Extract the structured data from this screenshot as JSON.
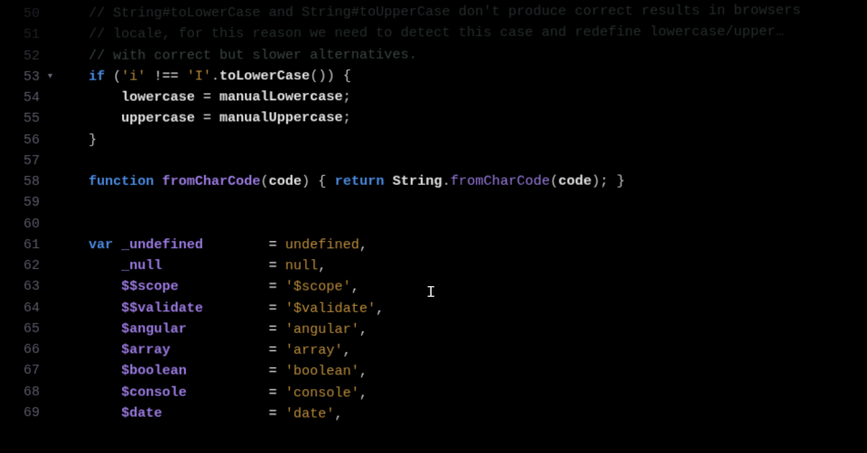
{
  "lines": [
    {
      "num": 50,
      "indent": 1,
      "tokens": [
        [
          "comment",
          "// String#toLowerCase and String#toUpperCase don't produce correct results in browsers"
        ]
      ],
      "dim": "dimmer"
    },
    {
      "num": 51,
      "indent": 1,
      "tokens": [
        [
          "comment",
          "// locale, for this reason we need to detect this case and redefine lowercase/upper…"
        ]
      ],
      "dim": "dimmer"
    },
    {
      "num": 52,
      "indent": 1,
      "tokens": [
        [
          "comment",
          "// with correct but slower alternatives."
        ]
      ],
      "dim": "dim"
    },
    {
      "num": 53,
      "indent": 1,
      "fold": true,
      "tokens": [
        [
          "keyword",
          "if"
        ],
        [
          "punc",
          " ("
        ],
        [
          "string",
          "'i'"
        ],
        [
          "op",
          " !== "
        ],
        [
          "string",
          "'I'"
        ],
        [
          "punc",
          "."
        ],
        [
          "ident",
          "toLowerCase"
        ],
        [
          "punc",
          "()) {"
        ]
      ]
    },
    {
      "num": 54,
      "indent": 2,
      "tokens": [
        [
          "ident",
          "lowercase"
        ],
        [
          "op",
          " = "
        ],
        [
          "ident",
          "manualLowercase"
        ],
        [
          "punc",
          ";"
        ]
      ]
    },
    {
      "num": 55,
      "indent": 2,
      "tokens": [
        [
          "ident",
          "uppercase"
        ],
        [
          "op",
          " = "
        ],
        [
          "ident",
          "manualUppercase"
        ],
        [
          "punc",
          ";"
        ]
      ]
    },
    {
      "num": 56,
      "indent": 1,
      "tokens": [
        [
          "punc",
          "}"
        ]
      ]
    },
    {
      "num": 57,
      "indent": 0,
      "tokens": []
    },
    {
      "num": 58,
      "indent": 1,
      "tokens": [
        [
          "keyword",
          "function"
        ],
        [
          "punc",
          " "
        ],
        [
          "func",
          "fromCharCode"
        ],
        [
          "punc",
          "("
        ],
        [
          "ident",
          "code"
        ],
        [
          "punc",
          ") { "
        ],
        [
          "keyword",
          "return"
        ],
        [
          "punc",
          " "
        ],
        [
          "obj",
          "String"
        ],
        [
          "punc",
          "."
        ],
        [
          "method",
          "fromCharCode"
        ],
        [
          "punc",
          "("
        ],
        [
          "ident",
          "code"
        ],
        [
          "punc",
          "); }"
        ]
      ]
    },
    {
      "num": 59,
      "indent": 0,
      "tokens": []
    },
    {
      "num": 60,
      "indent": 0,
      "tokens": []
    },
    {
      "num": 61,
      "indent": 1,
      "tokens": [
        [
          "keyword",
          "var"
        ],
        [
          "punc",
          " "
        ],
        [
          "var",
          "_undefined"
        ],
        [
          "pad",
          "        "
        ],
        [
          "op",
          "= "
        ],
        [
          "const",
          "undefined"
        ],
        [
          "punc",
          ","
        ]
      ]
    },
    {
      "num": 62,
      "indent": 2,
      "tokens": [
        [
          "var",
          "_null"
        ],
        [
          "pad",
          "             "
        ],
        [
          "op",
          "= "
        ],
        [
          "const",
          "null"
        ],
        [
          "punc",
          ","
        ]
      ]
    },
    {
      "num": 63,
      "indent": 2,
      "tokens": [
        [
          "var",
          "$$scope"
        ],
        [
          "pad",
          "           "
        ],
        [
          "op",
          "= "
        ],
        [
          "string",
          "'$scope'"
        ],
        [
          "punc",
          ","
        ]
      ]
    },
    {
      "num": 64,
      "indent": 2,
      "tokens": [
        [
          "var",
          "$$validate"
        ],
        [
          "pad",
          "        "
        ],
        [
          "op",
          "= "
        ],
        [
          "string",
          "'$validate'"
        ],
        [
          "punc",
          ","
        ]
      ]
    },
    {
      "num": 65,
      "indent": 2,
      "tokens": [
        [
          "var",
          "$angular"
        ],
        [
          "pad",
          "          "
        ],
        [
          "op",
          "= "
        ],
        [
          "string",
          "'angular'"
        ],
        [
          "punc",
          ","
        ]
      ]
    },
    {
      "num": 66,
      "indent": 2,
      "tokens": [
        [
          "var",
          "$array"
        ],
        [
          "pad",
          "            "
        ],
        [
          "op",
          "= "
        ],
        [
          "string",
          "'array'"
        ],
        [
          "punc",
          ","
        ]
      ]
    },
    {
      "num": 67,
      "indent": 2,
      "tokens": [
        [
          "var",
          "$boolean"
        ],
        [
          "pad",
          "          "
        ],
        [
          "op",
          "= "
        ],
        [
          "string",
          "'boolean'"
        ],
        [
          "punc",
          ","
        ]
      ]
    },
    {
      "num": 68,
      "indent": 2,
      "tokens": [
        [
          "var",
          "$console"
        ],
        [
          "pad",
          "          "
        ],
        [
          "op",
          "= "
        ],
        [
          "string",
          "'console'"
        ],
        [
          "punc",
          ","
        ]
      ]
    },
    {
      "num": 69,
      "indent": 2,
      "tokens": [
        [
          "var",
          "$date"
        ],
        [
          "pad",
          "             "
        ],
        [
          "op",
          "= "
        ],
        [
          "string",
          "'date'"
        ],
        [
          "punc",
          ","
        ]
      ]
    }
  ],
  "caret": {
    "line_index": 13,
    "after_col": 43,
    "glyph": "I"
  }
}
